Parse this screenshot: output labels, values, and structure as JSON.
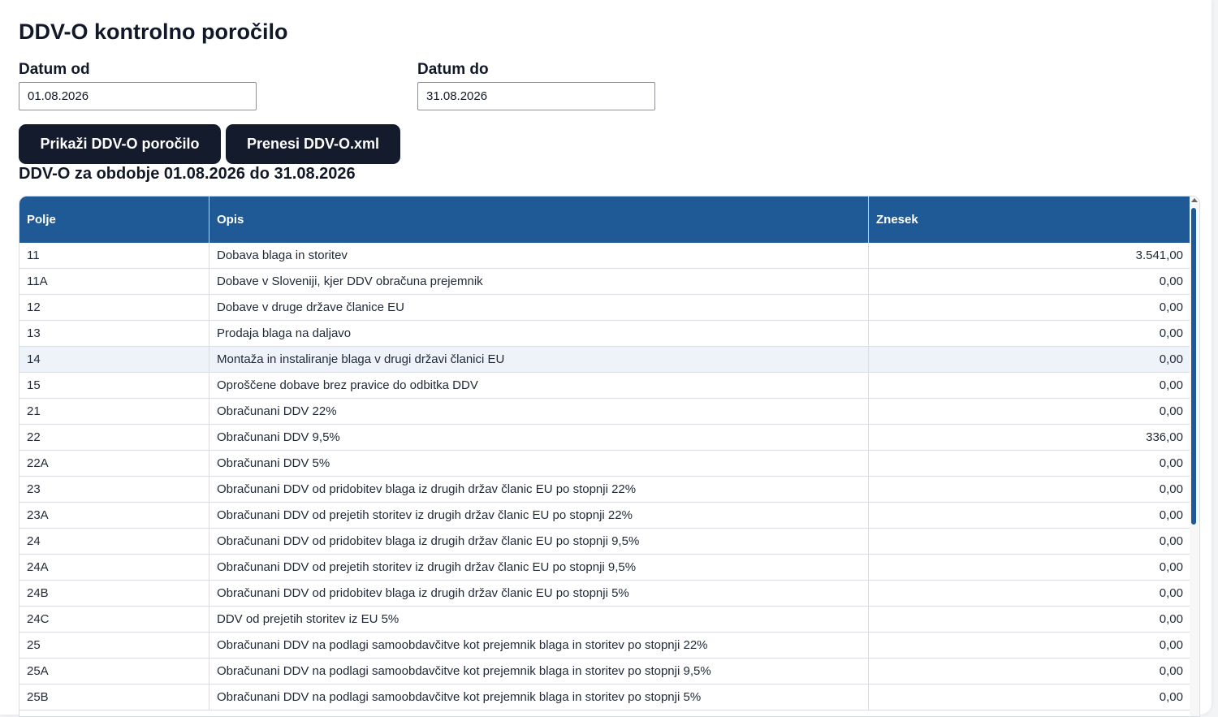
{
  "page": {
    "title": "DDV-O kontrolno poročilo"
  },
  "filters": {
    "date_from_label": "Datum od",
    "date_from_value": "01.08.2026",
    "date_to_label": "Datum do",
    "date_to_value": "31.08.2026"
  },
  "actions": {
    "show_report_label": "Prikaži DDV-O poročilo",
    "download_xml_label": "Prenesi DDV-O.xml"
  },
  "report": {
    "heading": "DDV-O za obdobje 01.08.2026 do 31.08.2026",
    "columns": [
      "Polje",
      "Opis",
      "Znesek"
    ],
    "rows": [
      {
        "polje": "11",
        "opis": "Dobava blaga in storitev",
        "znesek": "3.541,00"
      },
      {
        "polje": "11A",
        "opis": "Dobave v Sloveniji, kjer DDV obračuna prejemnik",
        "znesek": "0,00"
      },
      {
        "polje": "12",
        "opis": "Dobave v druge države članice EU",
        "znesek": "0,00"
      },
      {
        "polje": "13",
        "opis": "Prodaja blaga na daljavo",
        "znesek": "0,00"
      },
      {
        "polje": "14",
        "opis": "Montaža in instaliranje blaga v drugi državi članici EU",
        "znesek": "0,00"
      },
      {
        "polje": "15",
        "opis": "Oproščene dobave brez pravice do odbitka DDV",
        "znesek": "0,00"
      },
      {
        "polje": "21",
        "opis": "Obračunani DDV 22%",
        "znesek": "0,00"
      },
      {
        "polje": "22",
        "opis": "Obračunani DDV 9,5%",
        "znesek": "336,00"
      },
      {
        "polje": "22A",
        "opis": "Obračunani DDV 5%",
        "znesek": "0,00"
      },
      {
        "polje": "23",
        "opis": "Obračunani DDV od pridobitev blaga iz drugih držav članic EU po stopnji 22%",
        "znesek": "0,00"
      },
      {
        "polje": "23A",
        "opis": "Obračunani DDV od prejetih storitev iz drugih držav članic EU po stopnji 22%",
        "znesek": "0,00"
      },
      {
        "polje": "24",
        "opis": "Obračunani DDV od pridobitev blaga iz drugih držav članic EU po stopnji 9,5%",
        "znesek": "0,00"
      },
      {
        "polje": "24A",
        "opis": "Obračunani DDV od prejetih storitev iz drugih držav članic EU po stopnji 9,5%",
        "znesek": "0,00"
      },
      {
        "polje": "24B",
        "opis": "Obračunani DDV od pridobitev blaga iz drugih držav članic EU po stopnji 5%",
        "znesek": "0,00"
      },
      {
        "polje": "24C",
        "opis": "DDV od prejetih storitev iz EU 5%",
        "znesek": "0,00"
      },
      {
        "polje": "25",
        "opis": "Obračunani DDV na podlagi samoobdavčitve kot prejemnik blaga in storitev po stopnji 22%",
        "znesek": "0,00"
      },
      {
        "polje": "25A",
        "opis": "Obračunani DDV na podlagi samoobdavčitve kot prejemnik blaga in storitev po stopnji 9,5%",
        "znesek": "0,00"
      },
      {
        "polje": "25B",
        "opis": "Obračunani DDV na podlagi samoobdavčitve kot prejemnik blaga in storitev po stopnji 5%",
        "znesek": "0,00"
      }
    ],
    "highlighted_row": "14"
  },
  "colors": {
    "header_bg": "#1f5a96",
    "button_bg": "#141b2d",
    "row_highlight": "#eef3fa"
  }
}
